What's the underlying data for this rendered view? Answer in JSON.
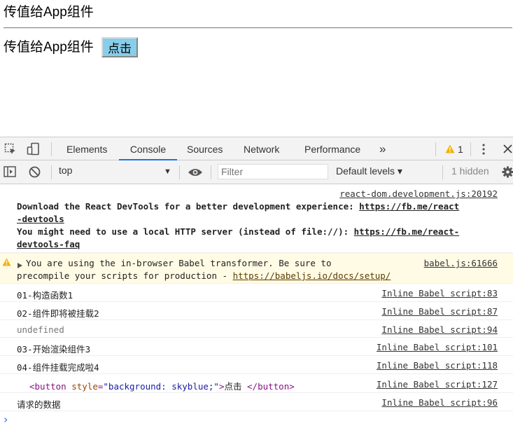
{
  "page": {
    "heading": "传值给App组件",
    "line2": "传值给App组件",
    "button_label": "点击"
  },
  "devtools": {
    "tabs": [
      "Elements",
      "Console",
      "Sources",
      "Network",
      "Performance"
    ],
    "active_tab": "Console",
    "more_tabs": "»",
    "warning_count": "1",
    "context": "top",
    "filter_placeholder": "Filter",
    "levels": "Default levels ▾",
    "hidden": "1 hidden"
  },
  "console": {
    "react_src": "react-dom.development.js:20192",
    "react_l1a": "Download the React DevTools for a better development experience: ",
    "react_l1b": "https://fb.me/react",
    "react_l2": "-devtools",
    "react_l3a": "You might need to use a local HTTP server (instead of file://): ",
    "react_l3b": "https://fb.me/react-",
    "react_l4": "devtools-faq",
    "warn_l1": "You are using the in-browser Babel transformer. Be sure to",
    "warn_l2a": "precompile your scripts for production - ",
    "warn_l2b": "https://babeljs.io/docs/setup/",
    "warn_src": "babel.js:61666",
    "logs": [
      {
        "msg": "01-构造函数1",
        "src": "Inline Babel script:83"
      },
      {
        "msg": "02-组件即将被挂载2",
        "src": "Inline Babel script:87"
      },
      {
        "msg": "undefined",
        "src": "Inline Babel script:94"
      },
      {
        "msg": "03-开始渲染组件3",
        "src": "Inline Babel script:101"
      },
      {
        "msg": "04-组件挂载完成啦4",
        "src": "Inline Babel script:118"
      },
      {
        "msg": "",
        "src": "Inline Babel script:127"
      },
      {
        "msg": "请求的数据",
        "src": "Inline Babel script:96"
      }
    ],
    "el": {
      "open": "<button ",
      "attr": "style",
      "eq": "=",
      "val": "\"background: skyblue;\"",
      "close": ">",
      "text": "点击 ",
      "end": "</button>"
    },
    "prompt": "›"
  }
}
